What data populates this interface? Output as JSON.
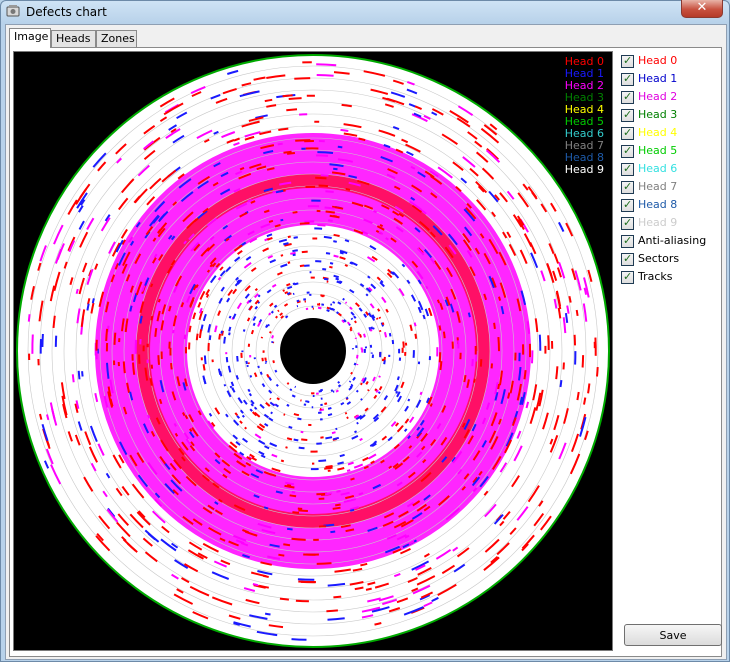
{
  "window": {
    "title": "Defects chart",
    "close_glyph": "✕"
  },
  "tabs": [
    {
      "label": "Image",
      "active": true
    },
    {
      "label": "Heads",
      "active": false
    },
    {
      "label": "Zones",
      "active": false
    }
  ],
  "legend": [
    {
      "label": "Head 0",
      "color": "#ff0000"
    },
    {
      "label": "Head 1",
      "color": "#1a1aff"
    },
    {
      "label": "Head 2",
      "color": "#ff00ff"
    },
    {
      "label": "Head 3",
      "color": "#008000"
    },
    {
      "label": "Head 4",
      "color": "#ffff00"
    },
    {
      "label": "Head 5",
      "color": "#00cc00"
    },
    {
      "label": "Head 6",
      "color": "#33cccc"
    },
    {
      "label": "Head 7",
      "color": "#808080"
    },
    {
      "label": "Head 8",
      "color": "#1e5aa8"
    },
    {
      "label": "Head 9",
      "color": "#ffffff"
    }
  ],
  "options": [
    {
      "label": "Head 0",
      "color": "#ff0000",
      "checked": true
    },
    {
      "label": "Head 1",
      "color": "#0000cc",
      "checked": true
    },
    {
      "label": "Head 2",
      "color": "#e000e0",
      "checked": true
    },
    {
      "label": "Head 3",
      "color": "#008000",
      "checked": true
    },
    {
      "label": "Head 4",
      "color": "#ffff00",
      "checked": true
    },
    {
      "label": "Head 5",
      "color": "#00cc00",
      "checked": true
    },
    {
      "label": "Head 6",
      "color": "#33e0e0",
      "checked": true
    },
    {
      "label": "Head 7",
      "color": "#808080",
      "checked": true
    },
    {
      "label": "Head 8",
      "color": "#1e5aa8",
      "checked": true
    },
    {
      "label": "Head 9",
      "color": "#cccccc",
      "checked": true
    },
    {
      "label": "Anti-aliasing",
      "color": "#000000",
      "checked": true
    },
    {
      "label": "Sectors",
      "color": "#000000",
      "checked": true
    },
    {
      "label": "Tracks",
      "color": "#000000",
      "checked": true
    }
  ],
  "save_label": "Save",
  "chart_data": {
    "type": "polar-defect-map",
    "background": "#000000",
    "platter_color": "#ffffff",
    "track_ring_color": "#c8c8c8",
    "outer_ring_color": "#00aa00",
    "defect_colors": {
      "head0": "#ff0000",
      "head1": "#1a1aff",
      "head2": "#ff00ff"
    }
  }
}
